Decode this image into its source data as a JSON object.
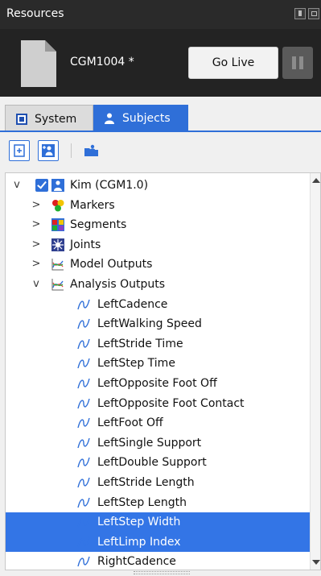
{
  "window": {
    "title": "Resources"
  },
  "live": {
    "trial_name": "CGM1004 *",
    "go_live_label": "Go Live"
  },
  "tabs": [
    {
      "label": "System",
      "active": false
    },
    {
      "label": "Subjects",
      "active": true
    }
  ],
  "toolbar": {
    "buttons": [
      "new-blank-subject-icon",
      "new-subject-from-template-icon",
      "open-subject-icon"
    ]
  },
  "tree": {
    "subject": {
      "label": "Kim (CGM1.0)",
      "checked": true,
      "expanded": true
    },
    "groups": [
      {
        "label": "Markers",
        "icon": "markers-icon",
        "expanded": false
      },
      {
        "label": "Segments",
        "icon": "segments-icon",
        "expanded": false
      },
      {
        "label": "Joints",
        "icon": "joints-icon",
        "expanded": false
      },
      {
        "label": "Model Outputs",
        "icon": "model-outputs-icon",
        "expanded": false
      },
      {
        "label": "Analysis Outputs",
        "icon": "analysis-outputs-icon",
        "expanded": true
      }
    ],
    "analysis_outputs": [
      {
        "label": "LeftCadence",
        "selected": false
      },
      {
        "label": "LeftWalking Speed",
        "selected": false
      },
      {
        "label": "LeftStride Time",
        "selected": false
      },
      {
        "label": "LeftStep Time",
        "selected": false
      },
      {
        "label": "LeftOpposite Foot Off",
        "selected": false
      },
      {
        "label": "LeftOpposite Foot Contact",
        "selected": false
      },
      {
        "label": "LeftFoot Off",
        "selected": false
      },
      {
        "label": "LeftSingle Support",
        "selected": false
      },
      {
        "label": "LeftDouble Support",
        "selected": false
      },
      {
        "label": "LeftStride Length",
        "selected": false
      },
      {
        "label": "LeftStep Length",
        "selected": false
      },
      {
        "label": "LeftStep Width",
        "selected": true
      },
      {
        "label": "LeftLimp Index",
        "selected": true
      },
      {
        "label": "RightCadence",
        "selected": false
      }
    ]
  },
  "colors": {
    "accent": "#2f6fd8",
    "selection": "#3375e6",
    "dark_panel": "#232323"
  }
}
